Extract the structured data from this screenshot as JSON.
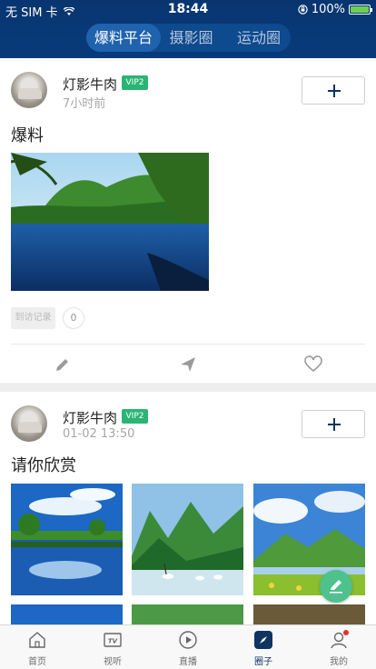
{
  "status_bar": {
    "carrier": "无 SIM 卡",
    "time": "18:44",
    "battery": "100%",
    "battery_level": 1.0
  },
  "top_tabs": [
    {
      "label": "爆料平台",
      "active": true
    },
    {
      "label": "摄影圈",
      "active": false
    },
    {
      "label": "运动圈",
      "active": false
    }
  ],
  "posts": [
    {
      "username": "灯影牛肉",
      "vip": "VIP2",
      "time": "7小时前",
      "title": "爆料",
      "visit_label": "到访记录",
      "visit_count": "0"
    },
    {
      "username": "灯影牛肉",
      "vip": "VIP2",
      "time": "01-02 13:50",
      "title": "请你欣赏"
    }
  ],
  "icons": {
    "follow": "plus-icon",
    "edit": "pencil-icon",
    "share": "send-icon",
    "like": "heart-icon",
    "fab": "compose-icon"
  },
  "colors": {
    "header_bg": "#083b7c",
    "vip_badge": "#2bb574",
    "fab": "#4ec18c",
    "active_tab": "#0f3464"
  },
  "bottom_tabs": [
    {
      "label": "首页",
      "icon": "home-icon",
      "active": false
    },
    {
      "label": "视听",
      "icon": "tv-icon",
      "active": false
    },
    {
      "label": "直播",
      "icon": "play-icon",
      "active": false
    },
    {
      "label": "圈子",
      "icon": "compass-icon",
      "active": true
    },
    {
      "label": "我的",
      "icon": "user-icon",
      "active": false,
      "badge": true
    }
  ]
}
